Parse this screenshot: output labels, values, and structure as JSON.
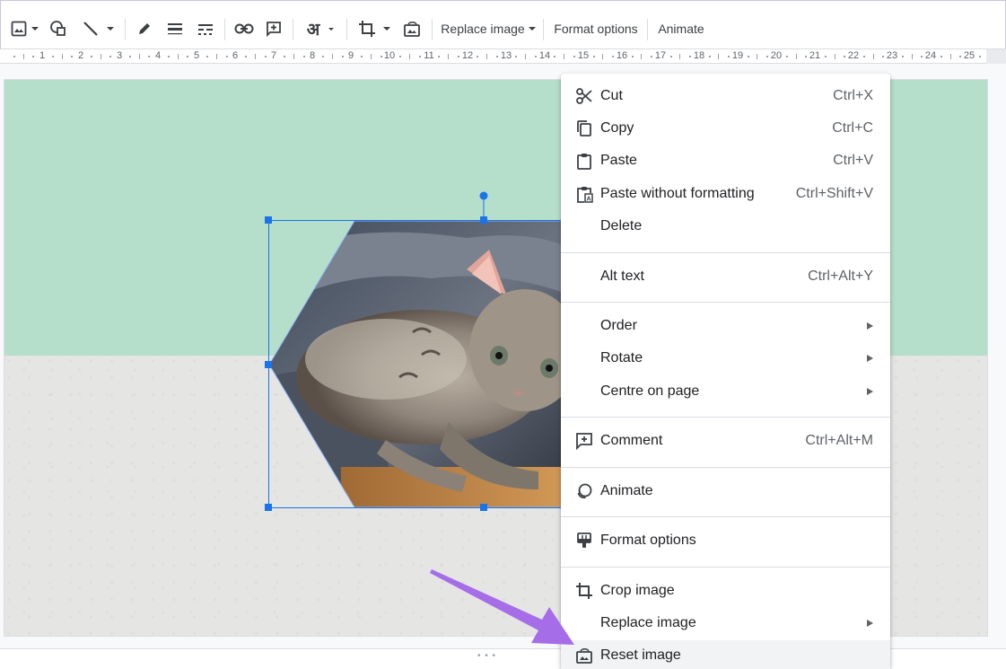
{
  "toolbar": {
    "replace_image_label": "Replace image",
    "format_options_label": "Format options",
    "animate_label": "Animate",
    "input_tools_glyph": "अ"
  },
  "ruler": {
    "numbers": [
      "1",
      "2",
      "3",
      "4",
      "5",
      "6",
      "7",
      "8",
      "9",
      "10",
      "11",
      "12",
      "13",
      "14",
      "15",
      "16",
      "17",
      "18",
      "19",
      "20",
      "21",
      "22",
      "23",
      "24",
      "25"
    ]
  },
  "slide": {
    "top_color": "#b5dfcb",
    "bottom_color": "#e5e5e3",
    "image": "kitten-photo-hexagon-mask"
  },
  "context_menu": {
    "items": [
      {
        "label": "Cut",
        "shortcut": "Ctrl+X",
        "icon": "scissors-icon"
      },
      {
        "label": "Copy",
        "shortcut": "Ctrl+C",
        "icon": "copy-icon"
      },
      {
        "label": "Paste",
        "shortcut": "Ctrl+V",
        "icon": "clipboard-icon"
      },
      {
        "label": "Paste without formatting",
        "shortcut": "Ctrl+Shift+V",
        "icon": "paste-plain-icon"
      },
      {
        "label": "Delete",
        "shortcut": ""
      },
      {
        "label": "Alt text",
        "shortcut": "Ctrl+Alt+Y"
      },
      {
        "label": "Order",
        "submenu": true
      },
      {
        "label": "Rotate",
        "submenu": true
      },
      {
        "label": "Centre on page",
        "submenu": true
      },
      {
        "label": "Comment",
        "shortcut": "Ctrl+Alt+M",
        "icon": "add-comment-icon"
      },
      {
        "label": "Animate",
        "icon": "animate-icon"
      },
      {
        "label": "Format options",
        "icon": "format-options-icon"
      },
      {
        "label": "Crop image",
        "icon": "crop-icon"
      },
      {
        "label": "Replace image",
        "submenu": true
      },
      {
        "label": "Reset image",
        "icon": "reset-image-icon",
        "highlighted": true
      }
    ]
  },
  "annotation": {
    "arrow_color": "#a66de8"
  }
}
